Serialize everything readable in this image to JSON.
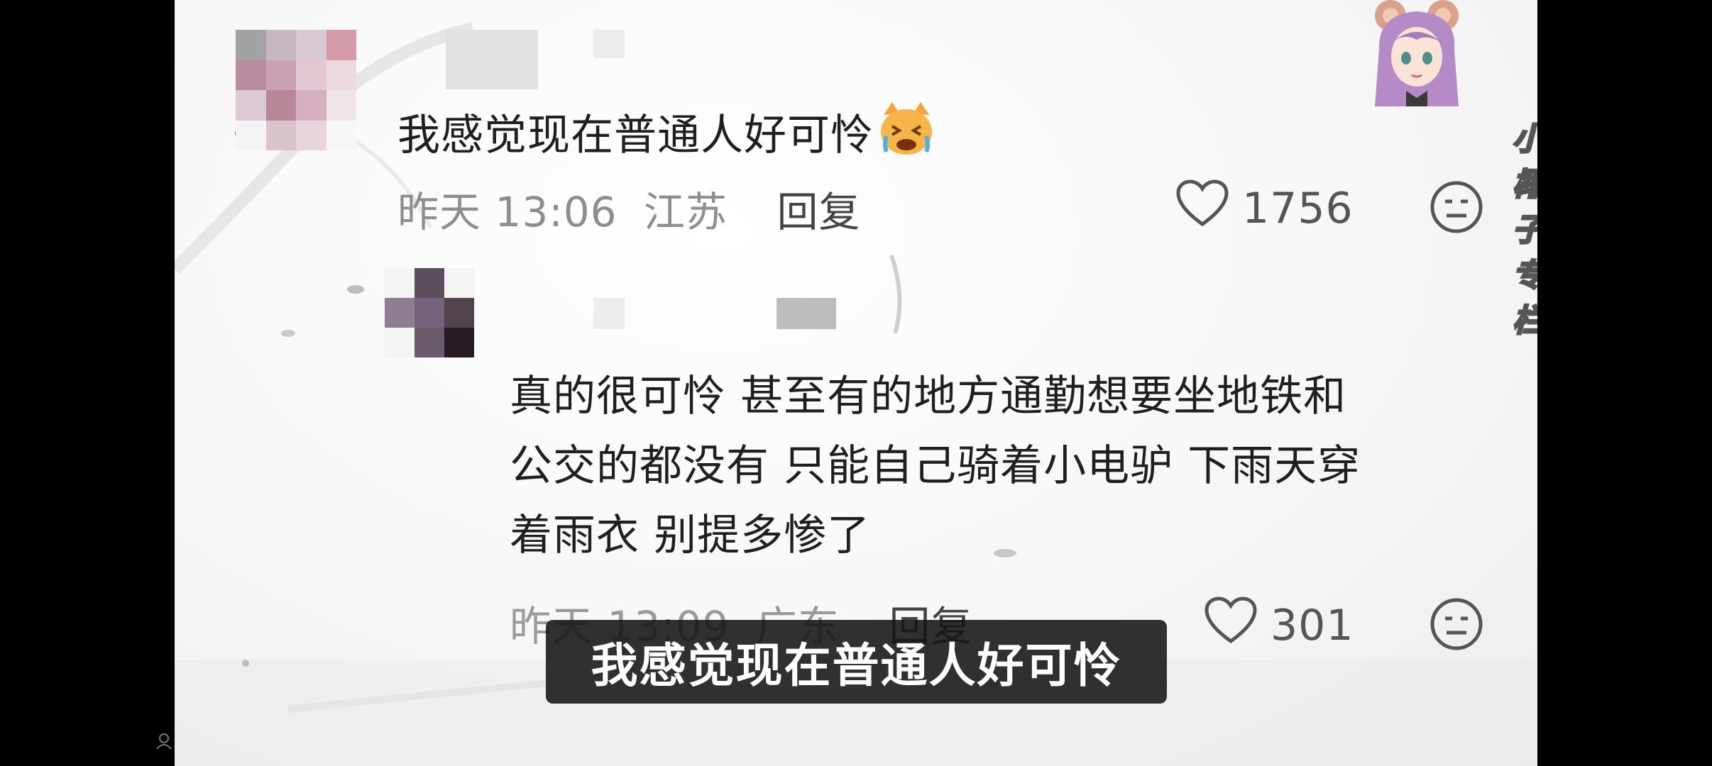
{
  "watermark": {
    "label": "小椰子专栏"
  },
  "comments": [
    {
      "text": "我感觉现在普通人好可怜",
      "emoji": "crying-cat-emoji",
      "time": "昨天 13:06",
      "location": "江苏",
      "reply_label": "回复",
      "likes": "1756"
    },
    {
      "text_lines": [
        "真的很可怜 甚至有的地方通勤想要坐地铁和",
        "公交的都没有 只能自己骑着小电驴 下雨天穿",
        "着雨衣 别提多惨了"
      ],
      "time": "昨天 13:09",
      "location": "广东",
      "reply_label": "回复",
      "likes": "301"
    }
  ],
  "subtitle": "我感觉现在普通人好可怜",
  "colors": {
    "background": "#000000",
    "frame": "#f5f5f5",
    "text": "#1f1f1f",
    "meta": "#8e8e8e",
    "subtitle_bg": "#141414"
  }
}
